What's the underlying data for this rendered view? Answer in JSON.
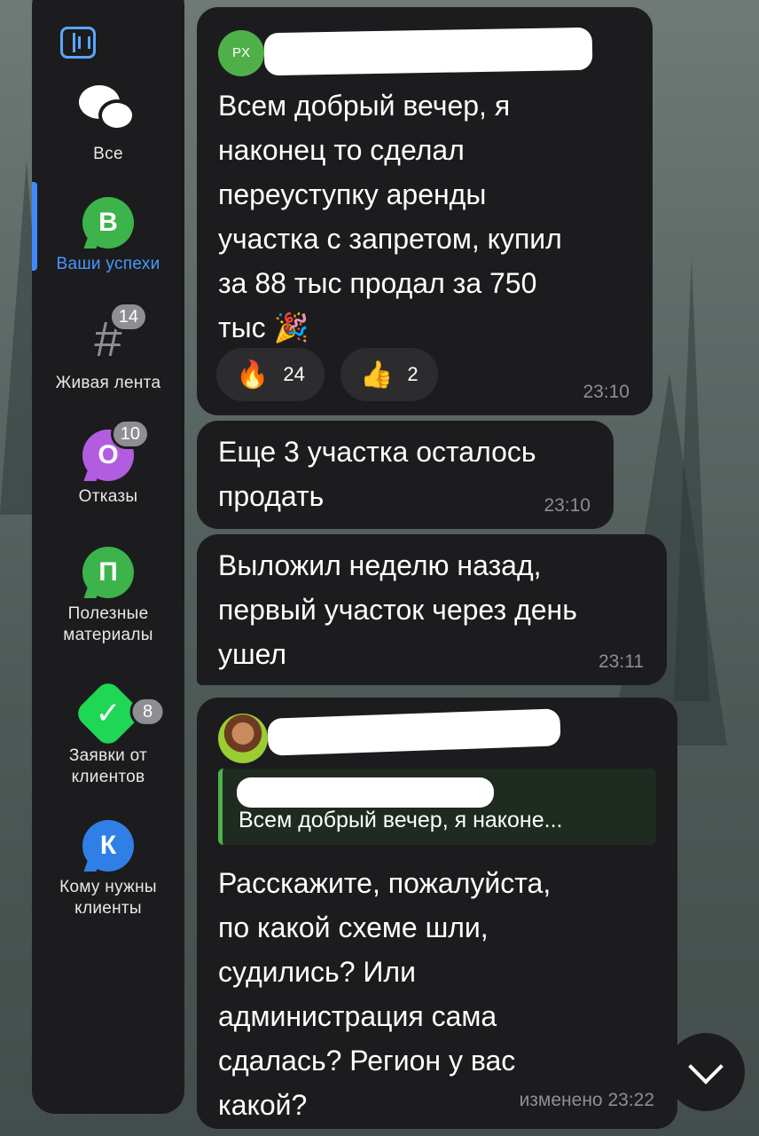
{
  "sidebar": {
    "items": [
      {
        "label": "Все",
        "icon": "chat-bubbles-icon"
      },
      {
        "label": "Ваши успехи",
        "letter": "В",
        "icon": "folder-letter-icon"
      },
      {
        "label": "Живая лента",
        "icon": "hashtag-icon",
        "badge": "14"
      },
      {
        "label": "Отказы",
        "letter": "О",
        "icon": "folder-letter-icon",
        "badge": "10"
      },
      {
        "label": "Полезные материалы",
        "letter": "П",
        "icon": "folder-letter-icon"
      },
      {
        "label": "Заявки от клиентов",
        "icon": "verified-check-icon",
        "badge": "8"
      },
      {
        "label": "Кому нужны клиенты",
        "letter": "К",
        "icon": "folder-letter-icon"
      }
    ],
    "active_index": 1,
    "colors": {
      "accent": "#3d8bff",
      "green": "#3cb44b",
      "purple": "#b25de0",
      "blue": "#2f7fe6"
    }
  },
  "messages": [
    {
      "avatar_initials": "PX",
      "text_lines": [
        "Всем добрый вечер, я",
        "наконец то сделал",
        "переуступку аренды",
        "участка с запретом, купил",
        "за 88 тыс продал за 750",
        "тыс 🎉"
      ],
      "reactions": [
        {
          "emoji": "🔥",
          "count": "24"
        },
        {
          "emoji": "👍",
          "count": "2"
        }
      ],
      "time": "23:10"
    },
    {
      "text_lines": [
        "Еще 3 участка осталось",
        "продать"
      ],
      "time": "23:10"
    },
    {
      "text_lines": [
        "Выложил неделю назад,",
        "первый участок через день",
        "ушел"
      ],
      "time": "23:11"
    },
    {
      "reply_preview": "Всем добрый вечер, я наконе...",
      "text_lines": [
        "Расскажите, пожалуйста,",
        "по какой схеме шли,",
        "судились? Или",
        "администрация сама",
        "сдалась? Регион у вас",
        "какой?"
      ],
      "time": "изменено 23:22"
    }
  ]
}
